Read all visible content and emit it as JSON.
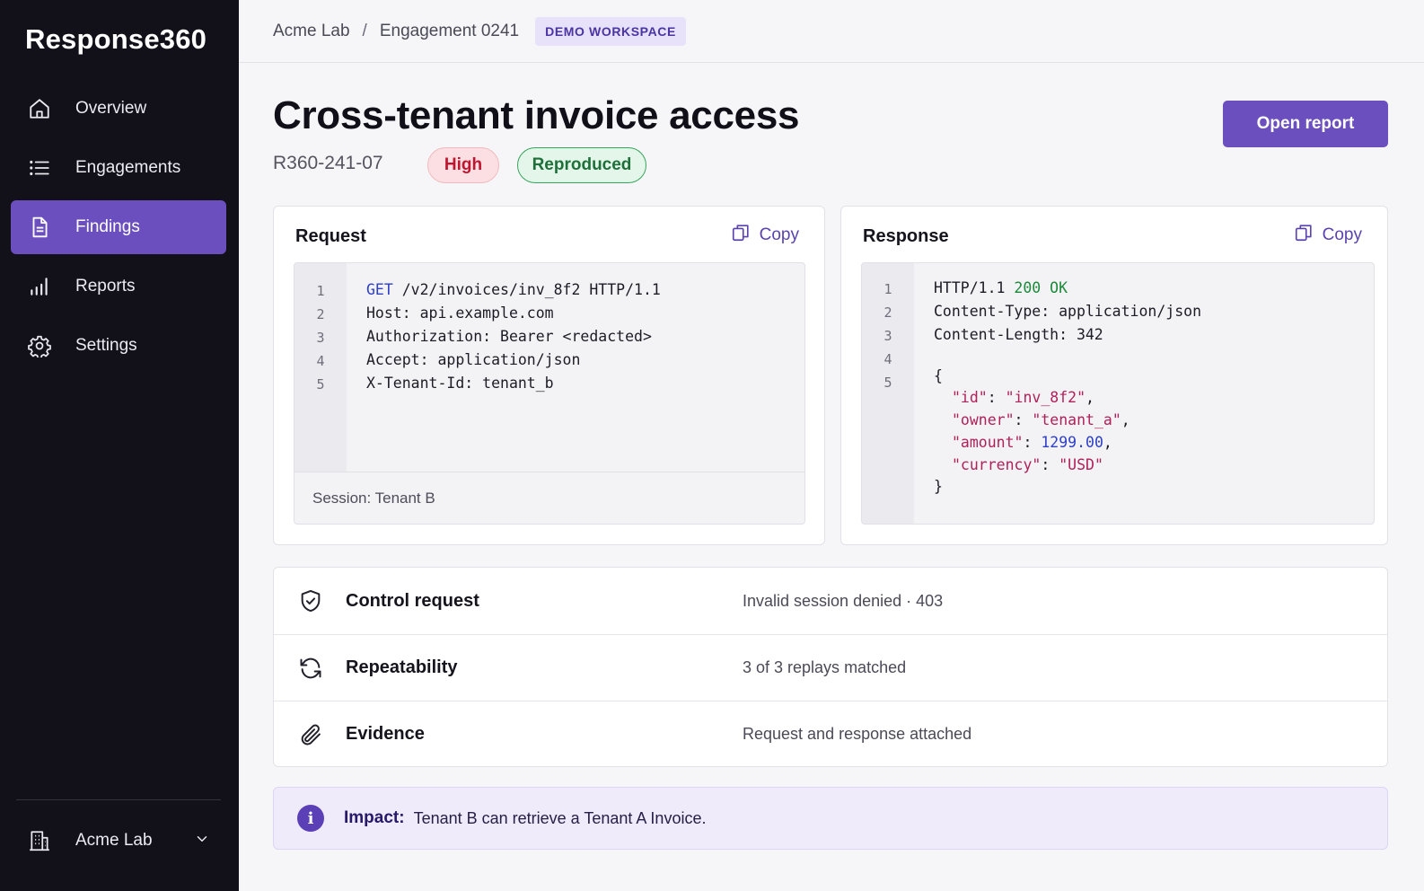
{
  "app": {
    "name": "Response360"
  },
  "sidebar": {
    "items": [
      {
        "label": "Overview",
        "icon": "home-icon",
        "active": false
      },
      {
        "label": "Engagements",
        "icon": "list-icon",
        "active": false
      },
      {
        "label": "Findings",
        "icon": "document-icon",
        "active": true
      },
      {
        "label": "Reports",
        "icon": "bar-chart-icon",
        "active": false
      },
      {
        "label": "Settings",
        "icon": "gear-icon",
        "active": false
      }
    ],
    "org": {
      "label": "Acme Lab",
      "icon": "building-icon"
    }
  },
  "breadcrumb": {
    "items": [
      "Acme Lab",
      "Engagement 0241"
    ],
    "separator": "/",
    "badge": "DEMO WORKSPACE"
  },
  "finding": {
    "title": "Cross-tenant invoice access",
    "id": "R360-241-07",
    "severity": "High",
    "status": "Reproduced",
    "open_report_label": "Open report"
  },
  "request": {
    "title": "Request",
    "copy_label": "Copy",
    "lines": [
      {
        "n": "1",
        "method": "GET",
        "text": " /v2/invoices/inv_8f2 HTTP/1.1"
      },
      {
        "n": "2",
        "text": "Host: api.example.com"
      },
      {
        "n": "3",
        "text": "Authorization: Bearer <redacted>"
      },
      {
        "n": "4",
        "text": "Accept: application/json"
      },
      {
        "n": "5",
        "text": "X-Tenant-Id: tenant_b"
      }
    ],
    "session": "Session: Tenant B"
  },
  "response": {
    "title": "Response",
    "copy_label": "Copy",
    "line_numbers": [
      "1",
      "2",
      "3",
      "4",
      "5"
    ],
    "status_prefix": "HTTP/1.1",
    "status_code": "200 OK",
    "headers": [
      "Content-Type: application/json",
      "Content-Length: 342"
    ],
    "body_open": "{",
    "body_close": "}",
    "body": [
      {
        "key": "\"id\"",
        "value": "\"inv_8f2\"",
        "type": "string"
      },
      {
        "key": "\"owner\"",
        "value": "\"tenant_a\"",
        "type": "string"
      },
      {
        "key": "\"amount\"",
        "value": "1299.00",
        "type": "number"
      },
      {
        "key": "\"currency\"",
        "value": "\"USD\"",
        "type": "string"
      }
    ]
  },
  "facts": [
    {
      "name": "Control request",
      "value": "Invalid session denied · 403",
      "icon": "shield-check-icon"
    },
    {
      "name": "Repeatability",
      "value": "3 of 3 replays matched",
      "icon": "refresh-icon"
    },
    {
      "name": "Evidence",
      "value": "Request and response attached",
      "icon": "paperclip-icon"
    }
  ],
  "impact": {
    "label": "Impact:",
    "text": "Tenant B can retrieve a Tenant A Invoice.",
    "icon": "info-icon"
  },
  "colors": {
    "accent": "#6b4fbf",
    "sidebar_bg": "#121018",
    "severity_high": "#c0152f",
    "status_reproduced": "#1f6f3b",
    "http_ok": "#1d8a3a"
  }
}
